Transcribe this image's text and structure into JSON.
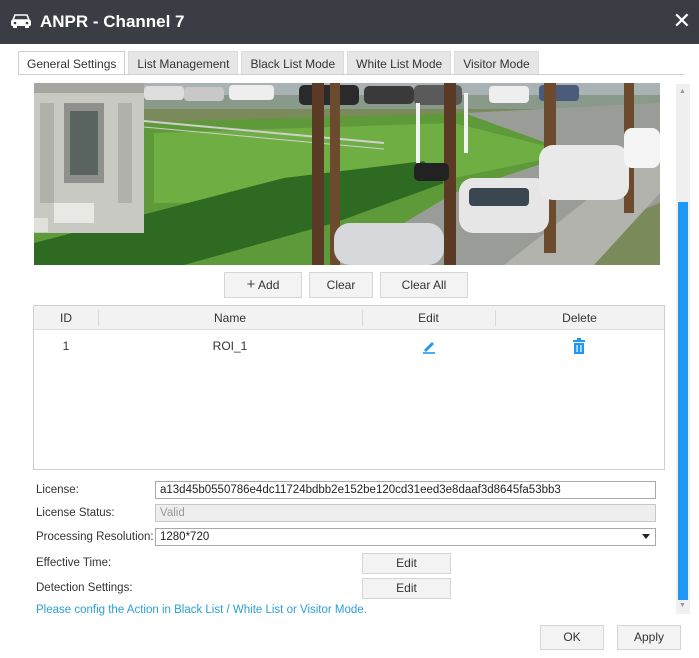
{
  "window": {
    "title": "ANPR - Channel 7",
    "close_glyph": "✕"
  },
  "tabs": [
    {
      "label": "General Settings",
      "active": true
    },
    {
      "label": "List Management",
      "active": false
    },
    {
      "label": "Black List Mode",
      "active": false
    },
    {
      "label": "White List Mode",
      "active": false
    },
    {
      "label": "Visitor Mode",
      "active": false
    }
  ],
  "roi_buttons": {
    "add_icon": "+",
    "add": "Add",
    "clear": "Clear",
    "clear_all": "Clear All"
  },
  "roi_table": {
    "columns": [
      "ID",
      "Name",
      "Edit",
      "Delete"
    ],
    "rows": [
      {
        "id": "1",
        "name": "ROI_1",
        "edit_icon": "pencil-icon",
        "delete_icon": "trash-icon"
      }
    ]
  },
  "form": {
    "license_label": "License:",
    "license_value": "a13d45b0550786e4dc11724bdbb2e152be120cd31eed3e8daaf3d8645fa53bb3",
    "license_status_label": "License Status:",
    "license_status_value": "Valid",
    "resolution_label": "Processing Resolution:",
    "resolution_value": "1280*720",
    "effective_time_label": "Effective Time:",
    "effective_time_button": "Edit",
    "detection_label": "Detection Settings:",
    "detection_button": "Edit"
  },
  "note": "Please config the Action in Black List / White List or Visitor Mode.",
  "footer": {
    "ok": "OK",
    "apply": "Apply"
  },
  "colors": {
    "titlebar": "#3a3d44",
    "accent": "#2196f3",
    "note": "#2a9fd6"
  }
}
